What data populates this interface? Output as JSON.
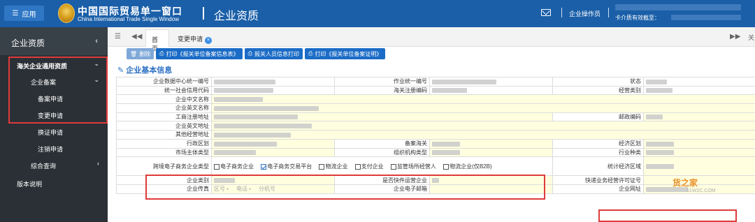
{
  "header": {
    "apps_label": "应用",
    "brand_cn": "中国国际贸易单一窗口",
    "brand_en": "China International Trade Single Window",
    "page_title": "企业资质",
    "user_role": "企业操作员",
    "cert_label": "卡介质有效截至："
  },
  "sidebar": {
    "title": "企业资质",
    "items": [
      {
        "label": "海关企业通用资质",
        "level": 1,
        "expanded": true
      },
      {
        "label": "企业备案",
        "level": 2,
        "expanded": true
      },
      {
        "label": "备案申请",
        "level": 3
      },
      {
        "label": "变更申请",
        "level": 3
      },
      {
        "label": "换证申请",
        "level": 2
      },
      {
        "label": "注销申请",
        "level": 2
      },
      {
        "label": "综合查询",
        "level": 1,
        "expanded": false
      },
      {
        "label": "版本说明",
        "level": 0
      }
    ]
  },
  "tabs": {
    "home": "首页",
    "change": "变更申请",
    "close_all": "关"
  },
  "toolbar": {
    "delete": "删除",
    "print_unit_info": "打印《报关单位备案信息表》",
    "print_staff": "报关人员信息打印",
    "print_unit_cert": "打印《报关单位备案证明》"
  },
  "section_title": "企业基本信息",
  "form": {
    "data_center_code": "企业数据中心统一编号",
    "operation_code": "作业统一编号",
    "status": "状态",
    "credit_code": "统一社会信用代码",
    "customs_reg_code": "海关注册编码",
    "business_category": "经营类别",
    "cn_name": "企业中文名称",
    "en_name": "企业英文名称",
    "reg_address": "工商注册地址",
    "postal_code": "邮政编码",
    "en_address": "企业英文地址",
    "other_address": "其他经营地址",
    "admin_region": "行政区划",
    "record_customs": "备案海关",
    "economic_zone": "经济区划",
    "market_subject_type": "市场主体类型",
    "org_type": "组织机构类型",
    "industry_type": "行业种类",
    "ecommerce_type": "跨境电子商务企业类型",
    "stat_economic_zone": "统计经济区域",
    "enterprise_category": "企业类别",
    "is_express": "是否快件运营企业",
    "express_license": "快递业务经营许可证号",
    "fax": "企业传真",
    "fax_ph_area": "区号",
    "fax_ph_phone": "电话",
    "fax_ph_ext": "分机号",
    "email": "企业电子邮箱",
    "website": "企业网址"
  },
  "ecommerce_options": [
    {
      "label": "电子商务企业",
      "checked": false
    },
    {
      "label": "电子商务交易平台",
      "checked": true
    },
    {
      "label": "物流企业",
      "checked": false
    },
    {
      "label": "支付企业",
      "checked": false
    },
    {
      "label": "监管场所经营人",
      "checked": false
    },
    {
      "label": "物流企业(仅B2B)",
      "checked": false
    }
  ],
  "watermark": {
    "text": "货之家",
    "sub": "51W2C.COM"
  }
}
